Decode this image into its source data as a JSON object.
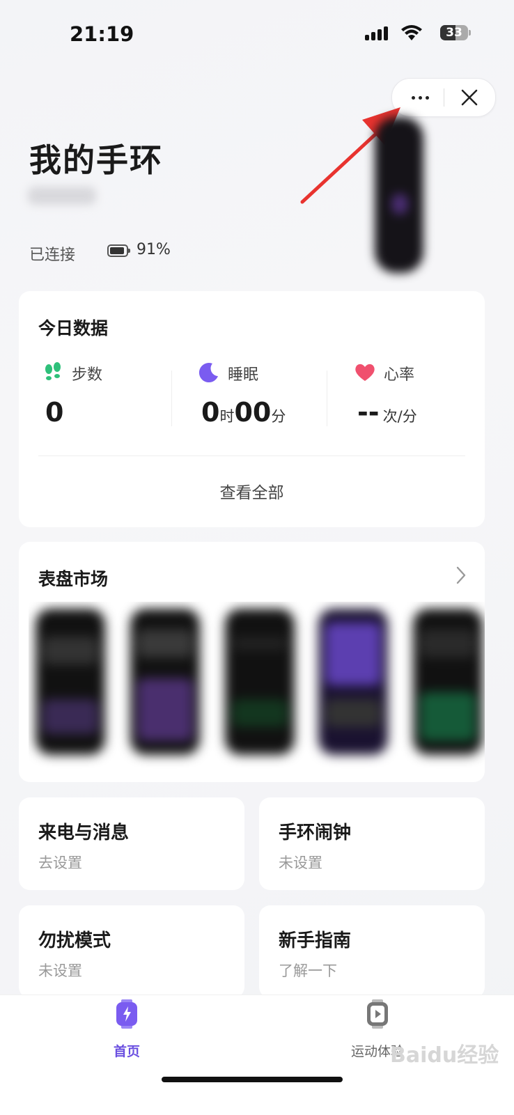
{
  "status_bar": {
    "time": "21:19",
    "battery": "33"
  },
  "header": {
    "title": "我的手环",
    "connection": "已连接",
    "battery_pct": "91%"
  },
  "today": {
    "title": "今日数据",
    "steps": {
      "label": "步数",
      "value": "0"
    },
    "sleep": {
      "label": "睡眠",
      "hours": "0",
      "hours_unit": "时",
      "minutes": "00",
      "minutes_unit": "分"
    },
    "heart": {
      "label": "心率",
      "value": "--",
      "unit": "次/分"
    },
    "view_all": "查看全部"
  },
  "market": {
    "title": "表盘市场"
  },
  "tiles": [
    {
      "title": "来电与消息",
      "subtitle": "去设置"
    },
    {
      "title": "手环闹钟",
      "subtitle": "未设置"
    },
    {
      "title": "勿扰模式",
      "subtitle": "未设置"
    },
    {
      "title": "新手指南",
      "subtitle": "了解一下"
    }
  ],
  "tabs": [
    {
      "label": "首页"
    },
    {
      "label": "运动体验"
    }
  ],
  "watermark": "Baidu经验",
  "colors": {
    "accent": "#7a5cf0",
    "steps": "#2ec07a",
    "sleep": "#7a5cf0",
    "heart": "#f0506e"
  }
}
